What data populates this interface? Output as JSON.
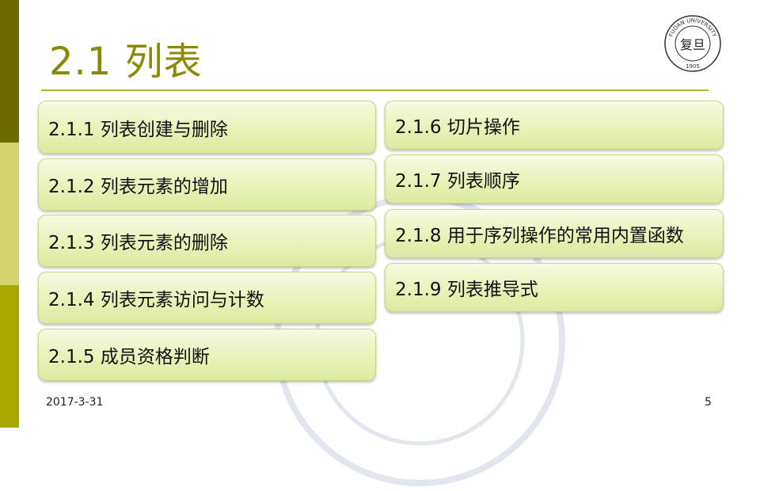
{
  "slide": {
    "title": "2.1 列表",
    "date": "2017-3-31",
    "page_number": "5"
  },
  "logo": {
    "arc_text": "FUDAN UNIVERSITY",
    "year": "1905",
    "center_glyph": "复旦"
  },
  "left_column": [
    {
      "label": "2.1.1 列表创建与删除"
    },
    {
      "label": "2.1.2 列表元素的增加"
    },
    {
      "label": "2.1.3 列表元素的删除"
    },
    {
      "label": "2.1.4 列表元素访问与计数"
    },
    {
      "label": "2.1.5 成员资格判断"
    }
  ],
  "right_column": [
    {
      "label": "2.1.6 切片操作"
    },
    {
      "label": "2.1.7 列表顺序"
    },
    {
      "label": "2.1.8 用于序列操作的常用内置函数"
    },
    {
      "label": "2.1.9 列表推导式"
    }
  ],
  "colors": {
    "accent_dark": "#6b6b00",
    "accent_light": "#d4d46e",
    "accent_mid": "#a8a800",
    "title": "#8a8a00",
    "box_fill": "#e8f2b8"
  }
}
